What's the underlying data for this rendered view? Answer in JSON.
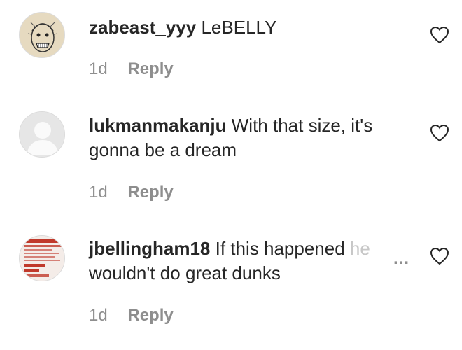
{
  "comments": [
    {
      "username": "zabeast_yyy",
      "text": "LeBELLY",
      "time": "1d",
      "reply_label": "Reply",
      "avatar_icon": "sketch-face-avatar",
      "like_icon": "heart-outline-icon"
    },
    {
      "username": "lukmanmakanju",
      "text": "With that size, it's gonna be a dream",
      "time": "1d",
      "reply_label": "Reply",
      "avatar_icon": "default-user-avatar",
      "like_icon": "heart-outline-icon"
    },
    {
      "username": "jbellingham18",
      "text": "If this happened",
      "text_faded": "he",
      "text_line2": "wouldn't do great dunks",
      "more_label": "...",
      "time": "1d",
      "reply_label": "Reply",
      "avatar_icon": "red-poster-avatar",
      "like_icon": "heart-outline-icon"
    }
  ],
  "colors": {
    "text_primary": "#262626",
    "text_secondary": "#8e8e8e",
    "border": "#dbdbdb",
    "avatar_poster_red": "#c0392b"
  }
}
